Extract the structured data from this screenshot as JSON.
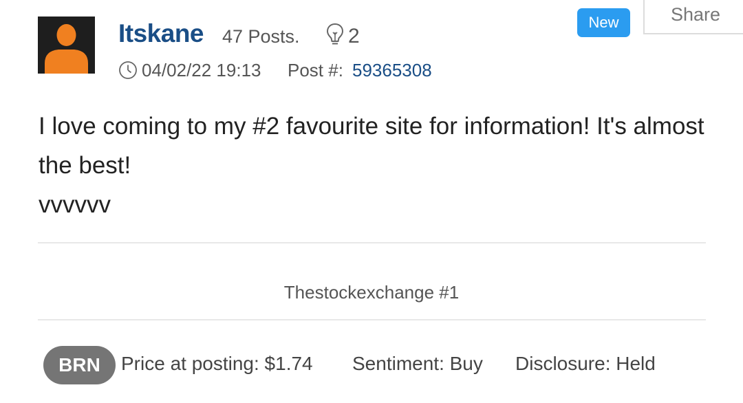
{
  "post": {
    "username": "Itskane",
    "posts_count": "47 Posts.",
    "likes": "2",
    "datetime": "04/02/22 19:13",
    "post_number_label": "Post #:",
    "post_number": "59365308",
    "new_badge": "New",
    "share_label": "Share",
    "body": [
      "I love coming to my #2 favourite site for information! It's almost the best!",
      "vvvvvv"
    ],
    "signature": "Thestockexchange #1"
  },
  "footer": {
    "ticker": "BRN",
    "price": "Price at posting: $1.74",
    "sentiment": "Sentiment: Buy",
    "disclosure": "Disclosure: Held"
  },
  "icons": {
    "avatar": "person-silhouette-icon",
    "likes": "lightbulb-icon",
    "time": "clock-icon"
  },
  "colors": {
    "username": "#1a4e86",
    "post_number": "#1a4e86",
    "new_badge": "#2b9cf0",
    "ticker_pill": "#757575",
    "avatar_bg": "#1e1e1e",
    "avatar_figure": "#f08020"
  }
}
